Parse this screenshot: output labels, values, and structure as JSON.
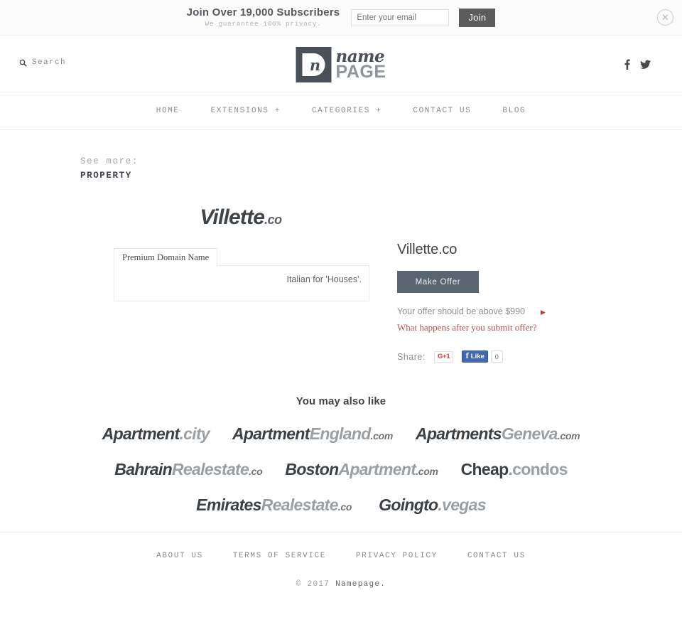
{
  "subscribe": {
    "title": "Join Over 19,000 Subscribers",
    "subtitle": "We guarantee 100% privacy.",
    "email_placeholder": "Enter your email",
    "email_value": "",
    "join_label": "Join",
    "close_icon": "close-circle-icon"
  },
  "header": {
    "search_label": "Search",
    "search_icon": "search-icon",
    "logo": {
      "mark_letter": "n",
      "name": "name",
      "page": "PAGE"
    },
    "social": [
      {
        "name": "facebook-icon",
        "glyph": "f"
      },
      {
        "name": "twitter-icon",
        "glyph": "t"
      }
    ]
  },
  "nav": {
    "items": [
      {
        "label": "HOME"
      },
      {
        "label": "EXTENSIONS +"
      },
      {
        "label": "CATEGORIES +"
      },
      {
        "label": "CONTACT US"
      },
      {
        "label": "BLOG"
      }
    ]
  },
  "seemore": {
    "label": "See more:",
    "category": "PROPERTY"
  },
  "product": {
    "logo_main": "Villette",
    "logo_tld": ".co",
    "tab_label": "Premium Domain Name",
    "description": "Italian for 'Houses'.",
    "title": "Villette.co",
    "make_offer_label": "Make Offer",
    "offer_hint": "Your offer should be above $990",
    "offer_link": "What happens after you submit offer?",
    "share_label": "Share:",
    "gplus_label": "G+1",
    "fb_like_label": "Like",
    "fb_count": "0"
  },
  "also_like": {
    "title": "You may also like",
    "rows": [
      [
        {
          "dark": "Apartment",
          "light": ".city",
          "tld": "",
          "upright": false
        },
        {
          "dark": "Apartment",
          "light": "England",
          "tld": ".com",
          "upright": false
        },
        {
          "dark": "Apartments",
          "light": "Geneva",
          "tld": ".com",
          "upright": false
        }
      ],
      [
        {
          "dark": "Bahrain",
          "light": "Realestate",
          "tld": ".co",
          "upright": false
        },
        {
          "dark": "Boston",
          "light": "Apartment",
          "tld": ".com",
          "upright": false
        },
        {
          "dark": "Cheap",
          "light": ".condos",
          "tld": "",
          "upright": true
        }
      ],
      [
        {
          "dark": "Emirates",
          "light": "Realestate",
          "tld": ".co",
          "upright": false
        },
        {
          "dark": "Goingto",
          "light": ".vegas",
          "tld": "",
          "upright": false
        }
      ]
    ]
  },
  "footer": {
    "links": [
      {
        "label": "ABOUT US"
      },
      {
        "label": "TERMS OF SERVICE"
      },
      {
        "label": "PRIVACY POLICY"
      },
      {
        "label": "CONTACT US"
      }
    ],
    "copyright_prefix": "© 2017 ",
    "copyright_brand": "Namepage."
  },
  "colors": {
    "accent_button": "#596570",
    "link_red": "#b5524b",
    "logo_dark": "#4a5058",
    "logo_gray": "#8e959b"
  }
}
